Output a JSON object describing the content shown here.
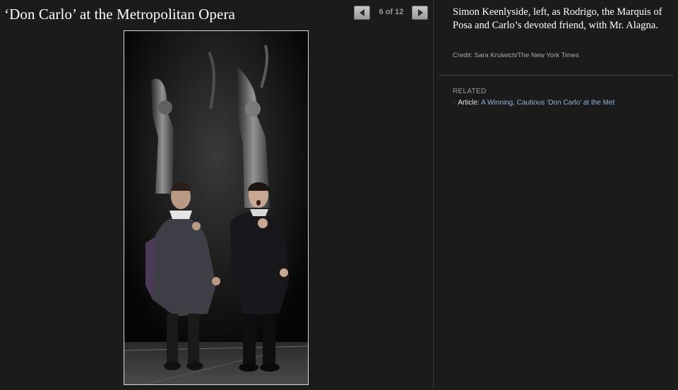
{
  "slideshow": {
    "title": "‘Don Carlo’ at the Metropolitan Opera",
    "counter": "6 of 12",
    "prev_icon": "left-arrow-icon",
    "next_icon": "right-arrow-icon"
  },
  "caption": {
    "text": "Simon Keenlyside, left, as Rodrigo, the Marquis of Posa and Carlo’s devoted friend, with Mr. Alagna.",
    "credit": "Credit: Sara Krulwich/The New York Times"
  },
  "related": {
    "heading": "RELATED",
    "items": [
      {
        "bullet": "·",
        "type_label": "Article:",
        "link_text": "A Winning, Cautious ‘Don Carlo’ at the Met"
      }
    ]
  },
  "colors": {
    "background": "#1b1b1b",
    "link": "#8fb6d8",
    "title": "#ffffff"
  }
}
